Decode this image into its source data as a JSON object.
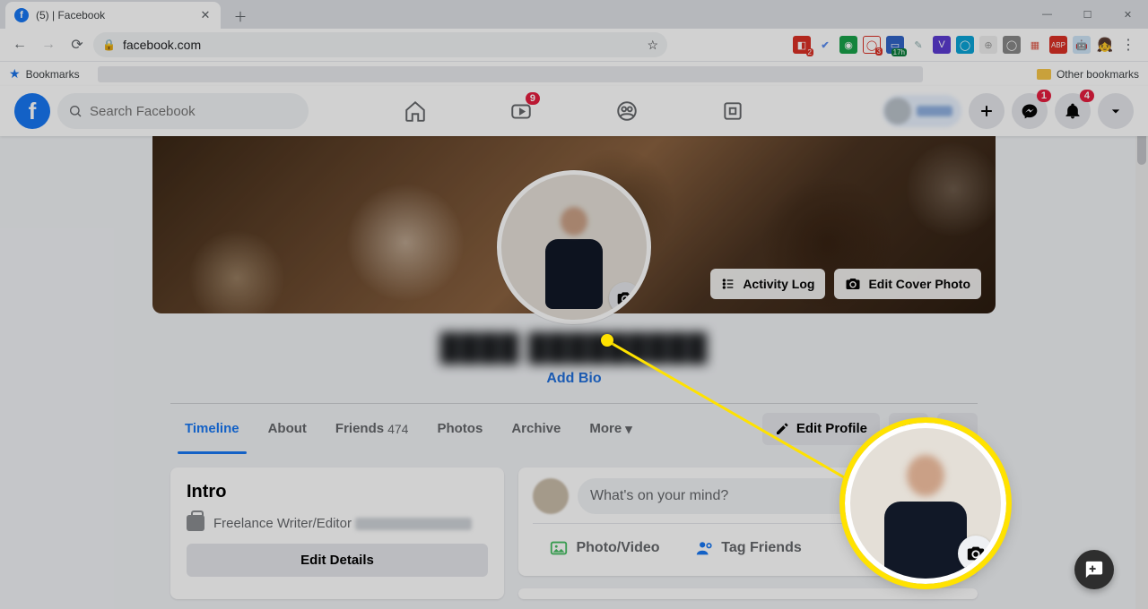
{
  "browser": {
    "tab": {
      "title": "(5)            | Facebook"
    },
    "url": "facebook.com",
    "bookmarks_label": "Bookmarks",
    "other_bookmarks": "Other bookmarks"
  },
  "fb_header": {
    "search_placeholder": "Search Facebook",
    "watch_badge": "9",
    "messenger_badge": "1",
    "notif_badge": "4"
  },
  "cover": {
    "activity_log": "Activity Log",
    "edit_cover": "Edit Cover Photo"
  },
  "profile": {
    "name": "████ █████████",
    "add_bio": "Add Bio"
  },
  "tabs": {
    "timeline": "Timeline",
    "about": "About",
    "friends": "Friends",
    "friends_count": "474",
    "photos": "Photos",
    "archive": "Archive",
    "more": "More"
  },
  "actions": {
    "edit_profile": "Edit Profile"
  },
  "intro": {
    "heading": "Intro",
    "work": "Freelance Writer/Editor",
    "edit_details": "Edit Details"
  },
  "composer": {
    "prompt": "What's on your mind?",
    "photo_video": "Photo/Video",
    "tag_friends": "Tag Friends"
  }
}
